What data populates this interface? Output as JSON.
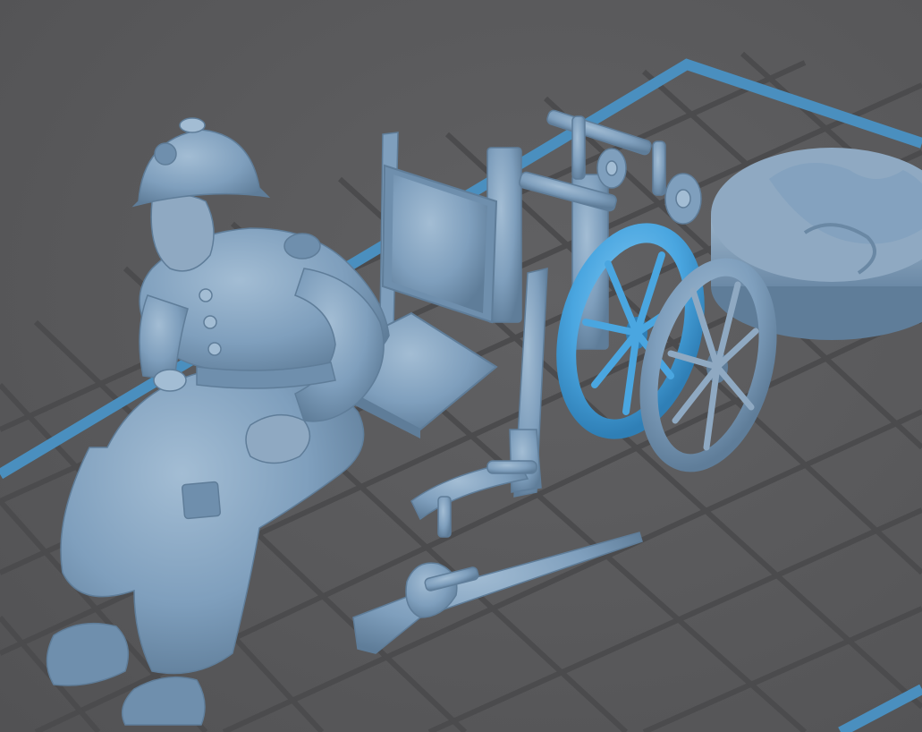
{
  "viewport": {
    "background": "#5a5a5c",
    "grid_color": "#4a4a4c",
    "bed_border_color": "#4a8fbf",
    "model_color": "#7f9fbd",
    "model_dark": "#5f7d99",
    "model_light": "#a3bdd4",
    "selected_color": "#4aa6e0"
  },
  "scene": {
    "objects": [
      {
        "name": "seated-soldier-figure",
        "selected": false
      },
      {
        "name": "wheelchair-seat",
        "selected": false
      },
      {
        "name": "wheelchair-frame",
        "selected": false
      },
      {
        "name": "wheelchair-side-rail",
        "selected": false
      },
      {
        "name": "wheelchair-wheel-left",
        "selected": true
      },
      {
        "name": "wheelchair-wheel-right",
        "selected": false
      },
      {
        "name": "round-base",
        "selected": false
      },
      {
        "name": "musket-with-hand",
        "selected": false
      }
    ]
  }
}
